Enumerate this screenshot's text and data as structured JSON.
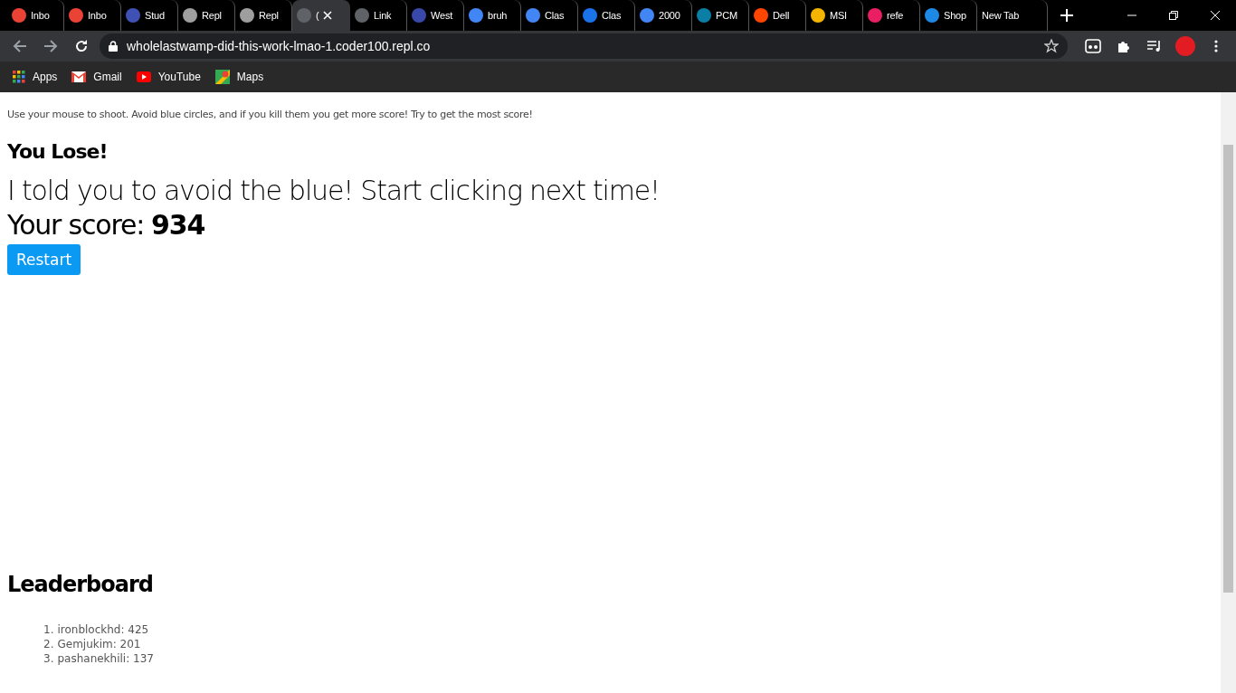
{
  "browser": {
    "tabs": [
      {
        "title": "Inbo",
        "color": "#ea4335",
        "selected": false
      },
      {
        "title": "Inbo",
        "color": "#ea4335",
        "selected": false
      },
      {
        "title": "Stud",
        "color": "#3f51b5",
        "selected": false
      },
      {
        "title": "Repl",
        "color": "#9e9e9e",
        "selected": false
      },
      {
        "title": "Repl",
        "color": "#9e9e9e",
        "selected": false
      },
      {
        "title": "(",
        "color": "#5f6368",
        "selected": true
      },
      {
        "title": "Link",
        "color": "#5f6368",
        "selected": false
      },
      {
        "title": "West",
        "color": "#3949ab",
        "selected": false
      },
      {
        "title": "bruh",
        "color": "#4285f4",
        "selected": false
      },
      {
        "title": "Clas",
        "color": "#4285f4",
        "selected": false
      },
      {
        "title": "Clas",
        "color": "#1a73e8",
        "selected": false
      },
      {
        "title": "2000",
        "color": "#4285f4",
        "selected": false
      },
      {
        "title": "PCM",
        "color": "#0a7ea4",
        "selected": false
      },
      {
        "title": "Dell",
        "color": "#ff4500",
        "selected": false
      },
      {
        "title": "MSI",
        "color": "#f4b400",
        "selected": false
      },
      {
        "title": "refe",
        "color": "#e91e63",
        "selected": false
      },
      {
        "title": "Shop",
        "color": "#1e88e5",
        "selected": false
      },
      {
        "title": "New Tab",
        "selected": false
      }
    ],
    "url": "wholelastwamp-did-this-work-lmao-1.coder100.repl.co",
    "bookmarks": [
      {
        "label": "Apps",
        "kind": "apps"
      },
      {
        "label": "Gmail",
        "kind": "gmail"
      },
      {
        "label": "YouTube",
        "kind": "youtube"
      },
      {
        "label": "Maps",
        "kind": "maps"
      }
    ]
  },
  "page": {
    "instructions": "Use your mouse to shoot. Avoid blue circles, and if you kill them you get more score! Try to get the most score!",
    "result_heading": "You Lose!",
    "message": "I told you to avoid the blue! Start clicking next time!",
    "score_label": "Your score:",
    "score": "934",
    "restart_button": "Restart",
    "leaderboard_heading": "Leaderboard",
    "leaderboard": [
      {
        "rank": "1.",
        "entry": "ironblockhd: 425"
      },
      {
        "rank": "2.",
        "entry": "Gemjukim: 201"
      },
      {
        "rank": "3.",
        "entry": "pashanekhili: 137"
      }
    ]
  }
}
